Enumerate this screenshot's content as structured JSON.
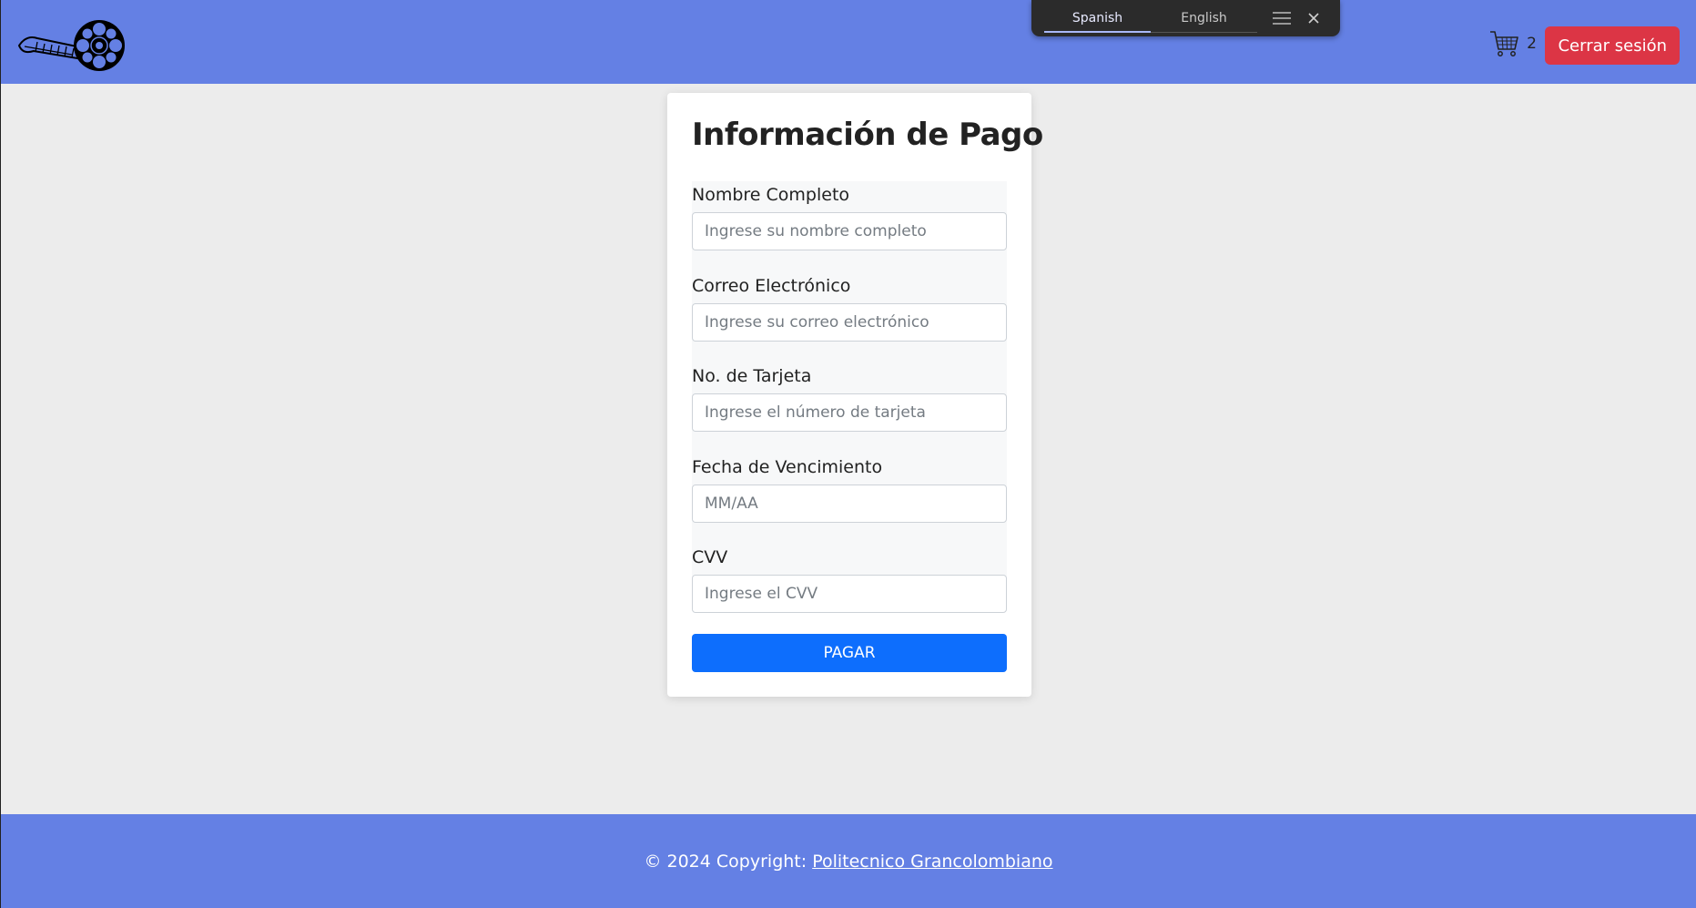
{
  "header": {
    "logo_icon": "film-reel-logo-icon",
    "cart_icon": "shopping-cart-icon",
    "cart_count": "2",
    "logout_label": "Cerrar sesión",
    "logout_color": "#dc3545",
    "background_color": "#6480e4"
  },
  "translate_popup": {
    "tabs": [
      {
        "label": "Spanish",
        "active": true
      },
      {
        "label": "English",
        "active": false
      }
    ],
    "menu_icon": "hamburger-menu-icon",
    "close_icon": "close-icon"
  },
  "payment": {
    "title": "Información de Pago",
    "fields": [
      {
        "label": "Nombre Completo",
        "placeholder": "Ingrese su nombre completo",
        "value": ""
      },
      {
        "label": "Correo Electrónico",
        "placeholder": "Ingrese su correo electrónico",
        "value": ""
      },
      {
        "label": "No. de Tarjeta",
        "placeholder": "Ingrese el número de tarjeta",
        "value": ""
      },
      {
        "label": "Fecha de Vencimiento",
        "placeholder": "MM/AA",
        "value": ""
      },
      {
        "label": "CVV",
        "placeholder": "Ingrese el CVV",
        "value": ""
      }
    ],
    "submit_label": "PAGAR",
    "submit_color": "#0d6efd"
  },
  "footer": {
    "copyright_text": "© 2024 Copyright: ",
    "link_text": "Politecnico Grancolombiano"
  }
}
